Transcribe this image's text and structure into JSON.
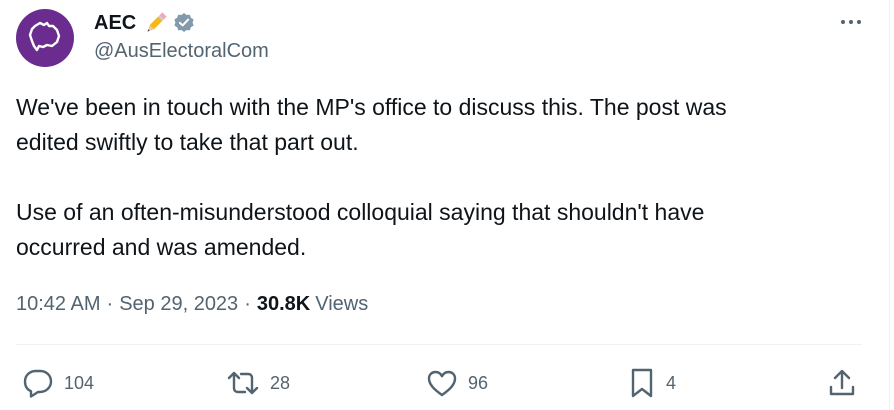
{
  "author": {
    "display_name": "AEC",
    "handle": "@AusElectoralCom",
    "name_emoji": "pencil-emoji",
    "badge": "verified-badge-icon",
    "avatar_icon": "australia-map-speech-bubble-icon",
    "avatar_color": "#6b2c8f"
  },
  "tweet": {
    "paragraph1_line1": "We've been in touch with the MP's office to discuss this. The post was",
    "paragraph1_line2": "edited swiftly to take that part out.",
    "paragraph2_line1": "Use of an often-misunderstood colloquial saying that shouldn't have",
    "paragraph2_line2": "occurred and was amended."
  },
  "meta": {
    "time": "10:42 AM",
    "separator": "·",
    "date": "Sep 29, 2023",
    "views_count": "30.8K",
    "views_label": "Views"
  },
  "actions": {
    "replies": "104",
    "reposts": "28",
    "likes": "96",
    "bookmarks": "4"
  },
  "colors": {
    "text_primary": "#0f1419",
    "text_secondary": "#536471",
    "divider": "#eff3f4"
  }
}
